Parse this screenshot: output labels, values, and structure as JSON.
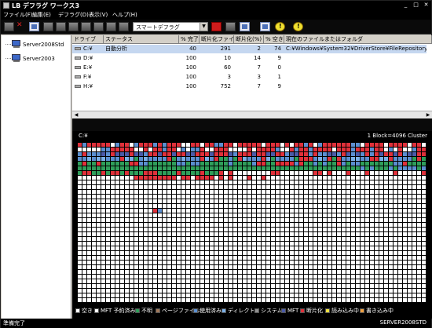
{
  "window": {
    "title": "LB デフラグ ワークス3"
  },
  "menu": [
    "ファイル(F)",
    "編集(E)",
    "デフラグ(D)",
    "表示(V)",
    "ヘルプ(H)"
  ],
  "toolbar": {
    "mode_select": "スマートデフラグ"
  },
  "servers": [
    "Server2008Std",
    "Server2003"
  ],
  "drive_table": {
    "columns": [
      "ドライブ",
      "ステータス",
      "% 完了",
      "断片化ファイル",
      "断片化(%)",
      "% 空き",
      "現在のファイルまたはフォルダ"
    ],
    "rows": [
      {
        "drive": "C:¥",
        "status": "自動分析",
        "complete": "40",
        "fragmented_files": "291",
        "fragmented_pct": "2",
        "free_pct": "74",
        "current": "C:¥Windows¥System32¥DriverStore¥FileRepository¥ph..."
      },
      {
        "drive": "D:¥",
        "status": "",
        "complete": "100",
        "fragmented_files": "10",
        "fragmented_pct": "14",
        "free_pct": "9",
        "current": ""
      },
      {
        "drive": "E:¥",
        "status": "",
        "complete": "100",
        "fragmented_files": "60",
        "fragmented_pct": "7",
        "free_pct": "0",
        "current": ""
      },
      {
        "drive": "F:¥",
        "status": "",
        "complete": "100",
        "fragmented_files": "3",
        "fragmented_pct": "3",
        "free_pct": "1",
        "current": ""
      },
      {
        "drive": "H:¥",
        "status": "",
        "complete": "100",
        "fragmented_files": "752",
        "fragmented_pct": "7",
        "free_pct": "9",
        "current": ""
      }
    ]
  },
  "cluster_map": {
    "drive": "C:¥",
    "block_info": "1 Block=4096 Cluster"
  },
  "legend": [
    {
      "label": "空き",
      "color": "#ffffff"
    },
    {
      "label": "MFT 予約済み",
      "color": "#ffffff"
    },
    {
      "label": "不明",
      "color": "#2f9e5a"
    },
    {
      "label": "ページファイル",
      "color": "#a0785a"
    },
    {
      "label": "使用済み",
      "color": "#5b8fd0"
    },
    {
      "label": "ディレクトリ",
      "color": "#7ab0e8"
    },
    {
      "label": "システム",
      "color": "#909090"
    },
    {
      "label": "MFT",
      "color": "#4a5aa8"
    },
    {
      "label": "断片化",
      "color": "#e0303a"
    },
    {
      "label": "読み込み中",
      "color": "#f0e040"
    },
    {
      "label": "書き込み中",
      "color": "#f0a040"
    }
  ],
  "statusbar": {
    "left": "準備完了",
    "right": "SERVER2008STD"
  }
}
